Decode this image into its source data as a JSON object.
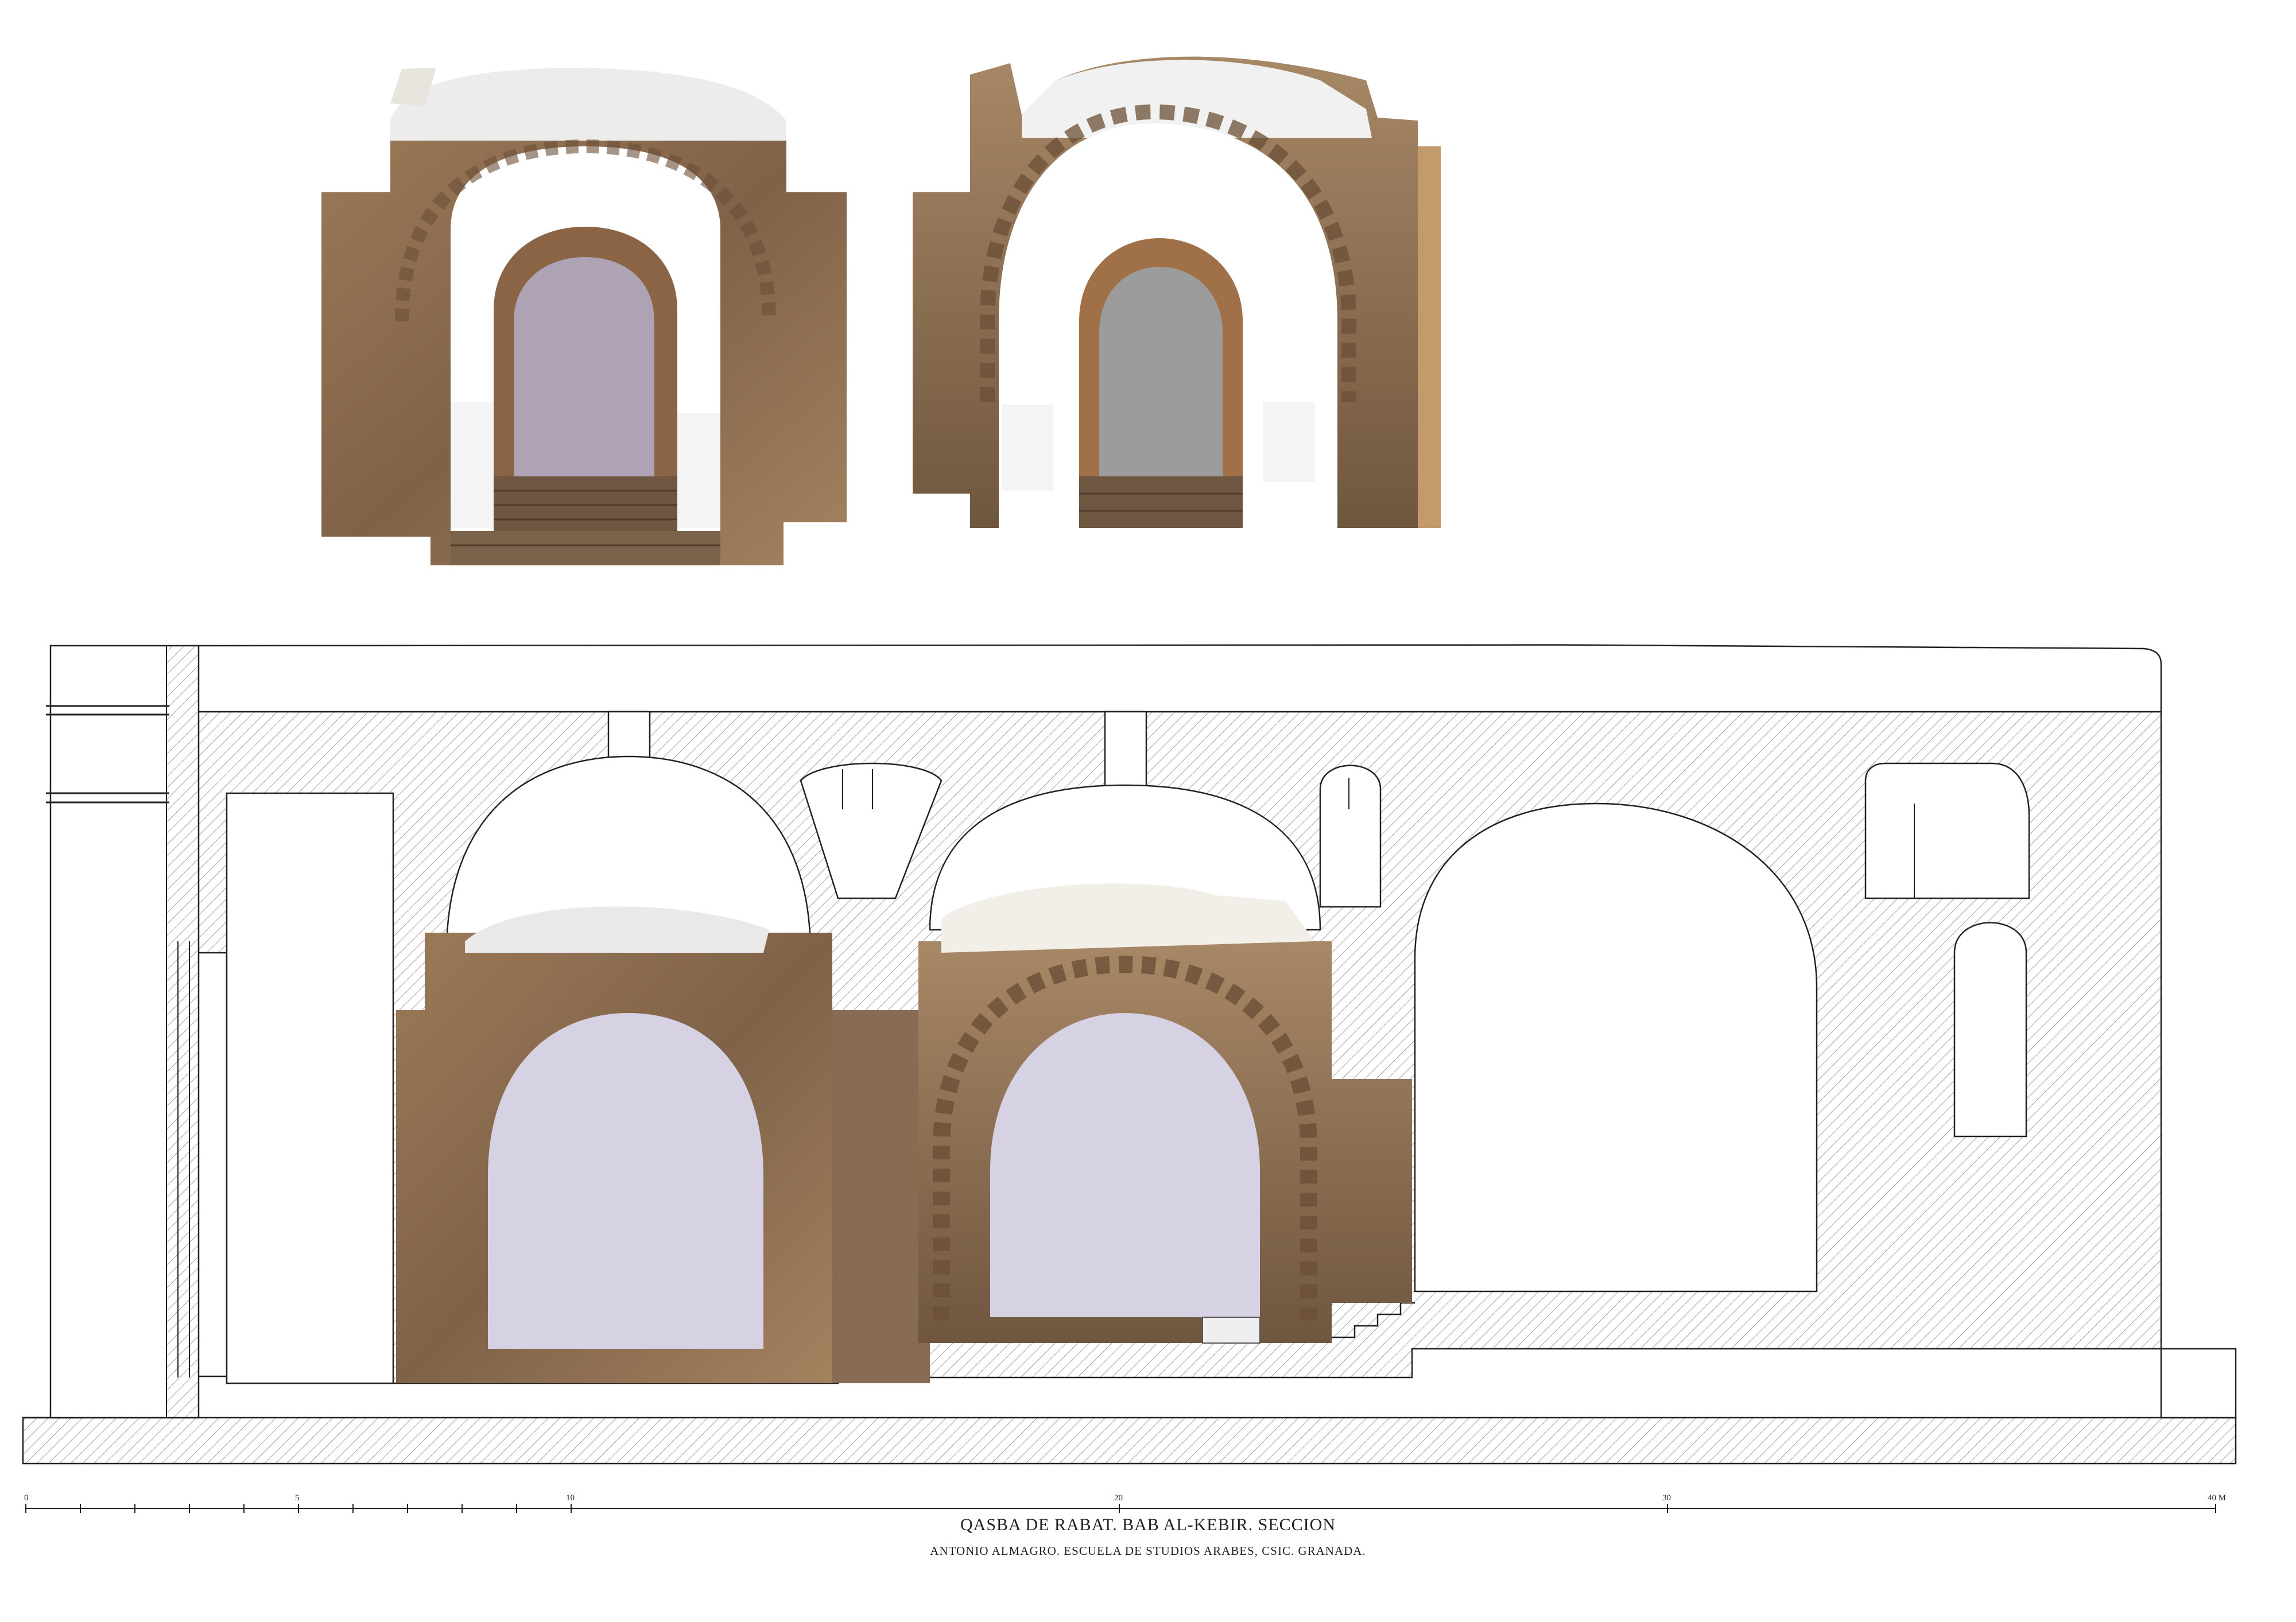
{
  "drawing": {
    "title": "QASBA DE RABAT. BAB AL-KEBIR. SECCION",
    "subtitle": "ANTONIO ALMAGRO. ESCUELA DE STUDIOS ARABES, CSIC. GRANADA."
  },
  "scale_bar": {
    "labels": [
      "0",
      "5",
      "10",
      "20",
      "30",
      "40 M"
    ]
  },
  "colors": {
    "stone": "#8a6c4f",
    "stone_light": "#b59572",
    "opening_fill": "#d6d2e4",
    "opening_fill_elev1": "#ada3b5",
    "opening_fill_elev2": "#9c9c9c",
    "wood_strip": "#c39a6c",
    "line": "#222222",
    "hatch": "#888888"
  }
}
